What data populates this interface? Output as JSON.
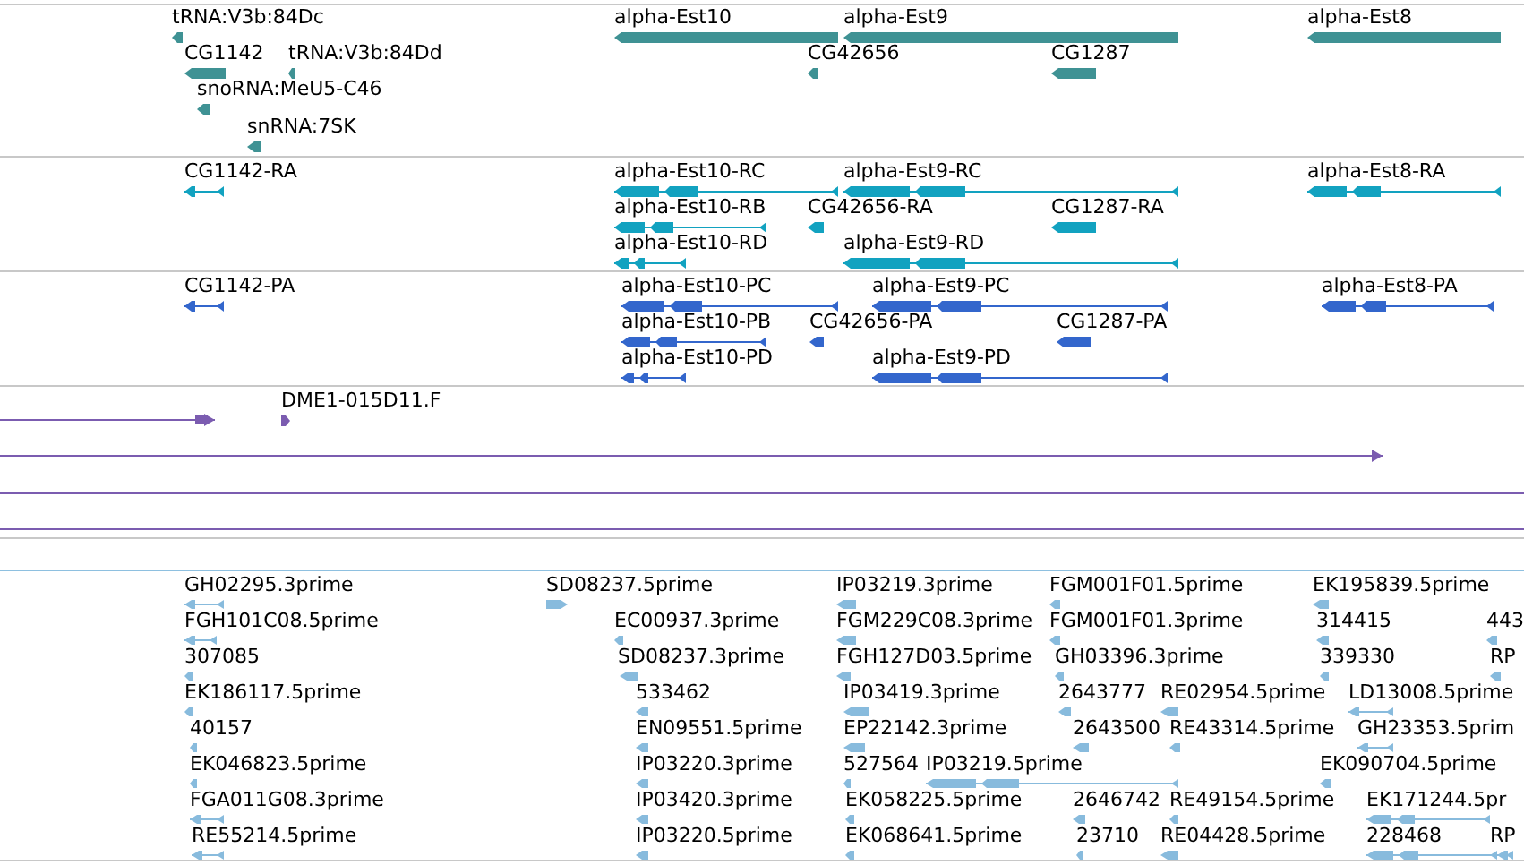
{
  "tracks": [
    {
      "features": [
        {
          "label": "tRNA:V3b:84Dc"
        },
        {
          "label": "alpha-Est10"
        },
        {
          "label": "alpha-Est9"
        },
        {
          "label": "alpha-Est8"
        },
        {
          "label": "CG1142"
        },
        {
          "label": "tRNA:V3b:84Dd"
        },
        {
          "label": "CG42656"
        },
        {
          "label": "CG1287"
        },
        {
          "label": "snoRNA:MeU5-C46"
        },
        {
          "label": "snRNA:7SK"
        }
      ]
    },
    {
      "features": [
        {
          "label": "CG1142-RA"
        },
        {
          "label": "alpha-Est10-RC"
        },
        {
          "label": "alpha-Est9-RC"
        },
        {
          "label": "alpha-Est8-RA"
        },
        {
          "label": "alpha-Est10-RB"
        },
        {
          "label": "CG42656-RA"
        },
        {
          "label": "CG1287-RA"
        },
        {
          "label": "alpha-Est10-RD"
        },
        {
          "label": "alpha-Est9-RD"
        }
      ]
    },
    {
      "features": [
        {
          "label": "CG1142-PA"
        },
        {
          "label": "alpha-Est10-PC"
        },
        {
          "label": "alpha-Est9-PC"
        },
        {
          "label": "alpha-Est8-PA"
        },
        {
          "label": "alpha-Est10-PB"
        },
        {
          "label": "CG42656-PA"
        },
        {
          "label": "CG1287-PA"
        },
        {
          "label": "alpha-Est10-PD"
        },
        {
          "label": "alpha-Est9-PD"
        }
      ]
    },
    {
      "features": [
        {
          "label": "DME1-015D11.F"
        }
      ]
    },
    {
      "features": [
        {
          "label": "GH02295.3prime"
        },
        {
          "label": "FGH101C08.5prime"
        },
        {
          "label": "307085"
        },
        {
          "label": "EK186117.5prime"
        },
        {
          "label": "40157"
        },
        {
          "label": "EK046823.5prime"
        },
        {
          "label": "FGA011G08.3prime"
        },
        {
          "label": "RE55214.5prime"
        },
        {
          "label": "SD08237.5prime"
        },
        {
          "label": "EC00937.3prime"
        },
        {
          "label": "SD08237.3prime"
        },
        {
          "label": "533462"
        },
        {
          "label": "EN09551.5prime"
        },
        {
          "label": "IP03220.3prime"
        },
        {
          "label": "IP03420.3prime"
        },
        {
          "label": "IP03220.5prime"
        },
        {
          "label": "IP03219.3prime"
        },
        {
          "label": "FGM229C08.3prime"
        },
        {
          "label": "FGH127D03.5prime"
        },
        {
          "label": "IP03419.3prime"
        },
        {
          "label": "EP22142.3prime"
        },
        {
          "label": "527564"
        },
        {
          "label": "EK058225.5prime"
        },
        {
          "label": "EK068641.5prime"
        },
        {
          "label": "FGM001F01.5prime"
        },
        {
          "label": "FGM001F01.3prime"
        },
        {
          "label": "GH03396.3prime"
        },
        {
          "label": "2643777"
        },
        {
          "label": "2643500"
        },
        {
          "label": "IP03219.5prime"
        },
        {
          "label": "2646742"
        },
        {
          "label": "23710"
        },
        {
          "label": "RE02954.5prime"
        },
        {
          "label": "RE43314.5prime"
        },
        {
          "label": "RE49154.5prime"
        },
        {
          "label": "RE04428.5prime"
        },
        {
          "label": "EK195839.5prime"
        },
        {
          "label": "314415"
        },
        {
          "label": "339330"
        },
        {
          "label": "LD13008.5prime"
        },
        {
          "label": "GH23353.5prim"
        },
        {
          "label": "EK090704.5prime"
        },
        {
          "label": "EK171244.5pr"
        },
        {
          "label": "228468"
        },
        {
          "label": "443"
        },
        {
          "label": "RP"
        },
        {
          "label": "RP"
        }
      ]
    }
  ]
}
